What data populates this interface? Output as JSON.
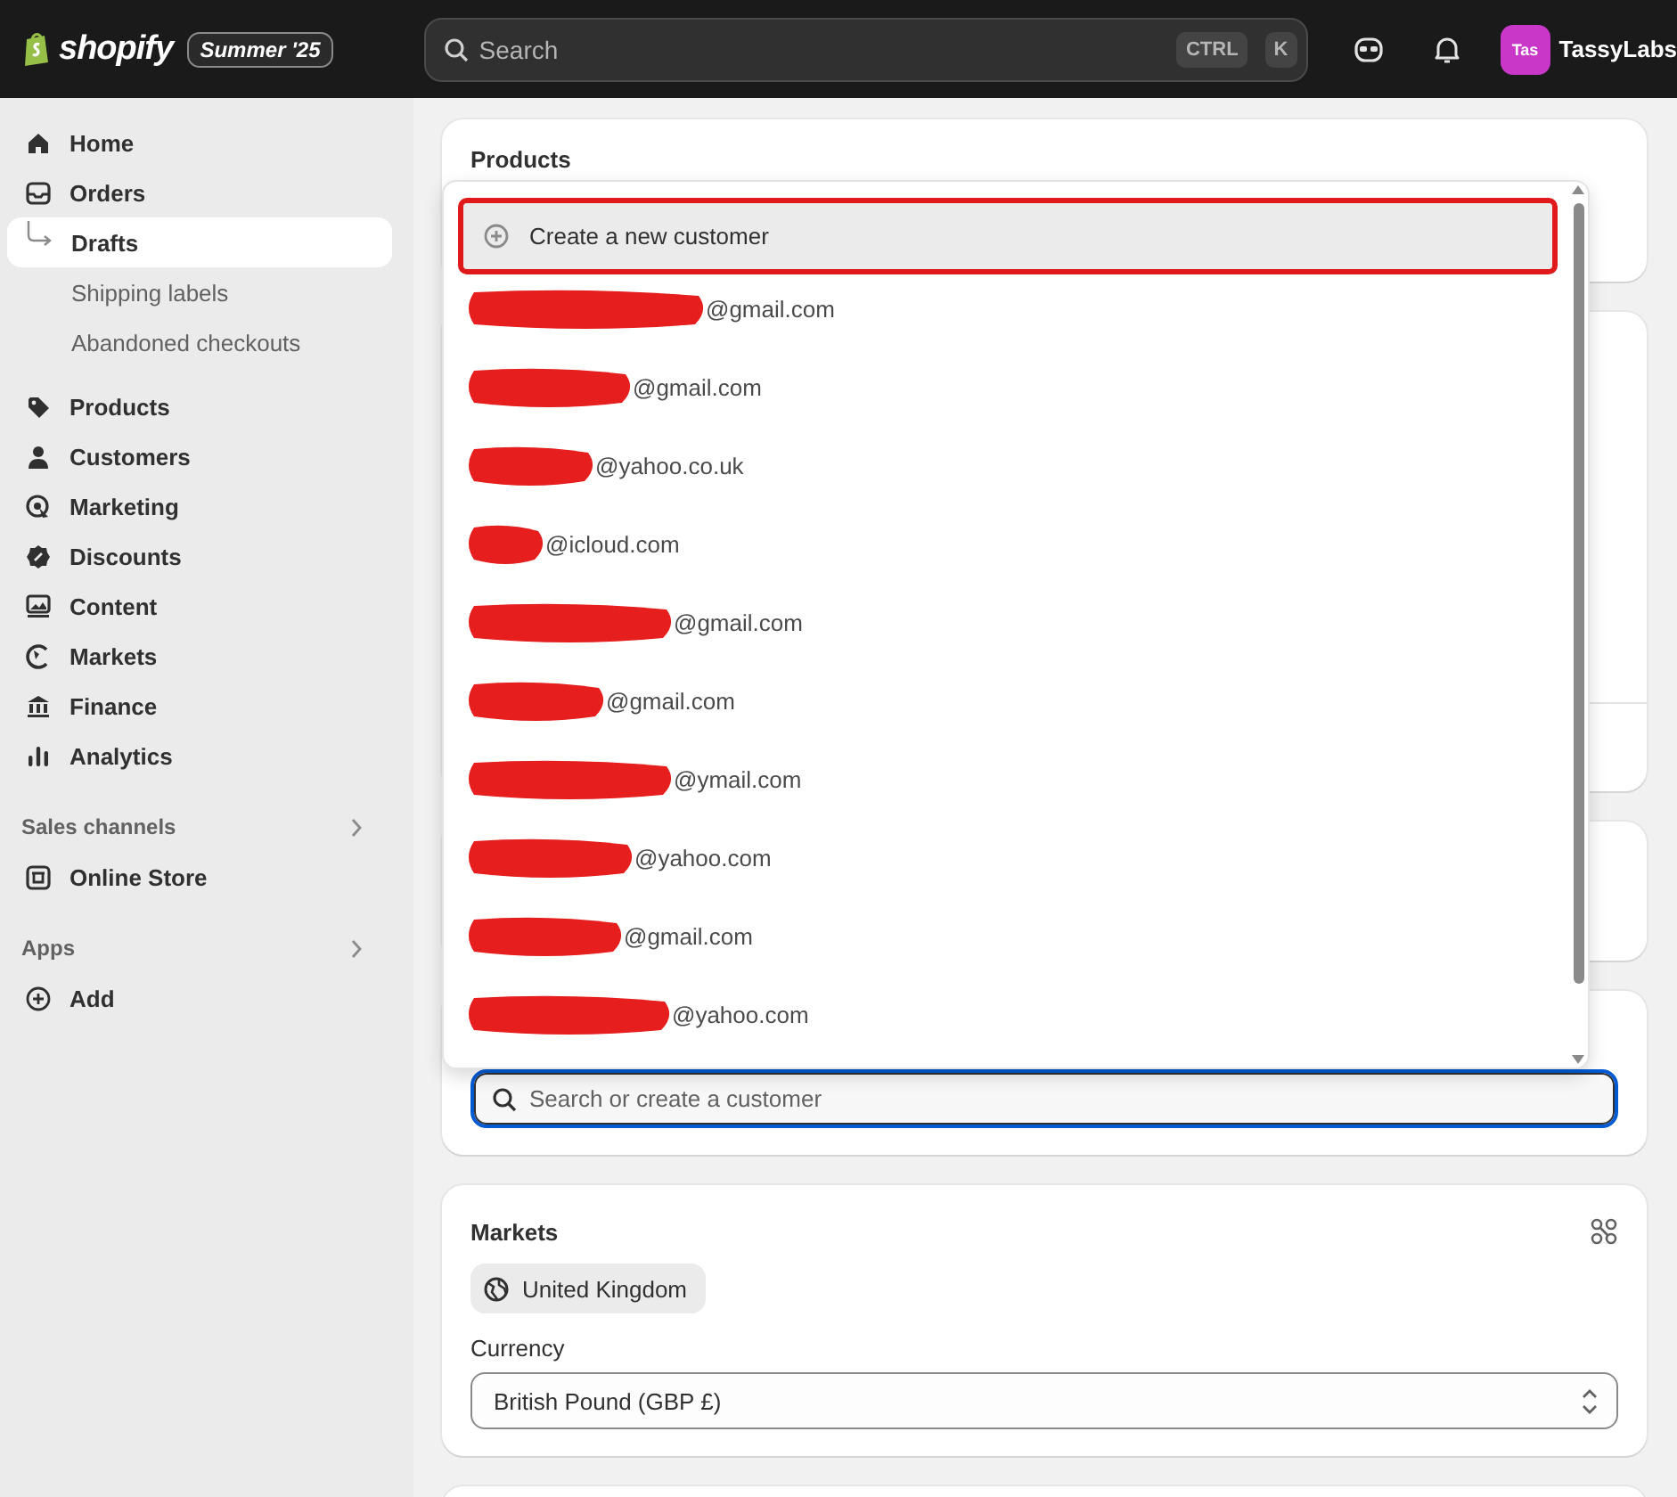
{
  "topbar": {
    "logo_text": "shopify",
    "edition_badge": "Summer '25",
    "search": {
      "placeholder": "Search"
    },
    "shortcut_keys": [
      "CTRL",
      "K"
    ],
    "store_avatar": "Tas",
    "store_name": "TassyLabs"
  },
  "sidebar": {
    "items": [
      {
        "label": "Home",
        "selected": false
      },
      {
        "label": "Orders",
        "selected": false,
        "children": [
          {
            "label": "Drafts",
            "selected": true
          },
          {
            "label": "Shipping labels",
            "selected": false
          },
          {
            "label": "Abandoned checkouts",
            "selected": false
          }
        ]
      },
      {
        "label": "Products",
        "selected": false
      },
      {
        "label": "Customers",
        "selected": false
      },
      {
        "label": "Marketing",
        "selected": false
      },
      {
        "label": "Discounts",
        "selected": false
      },
      {
        "label": "Content",
        "selected": false
      },
      {
        "label": "Markets",
        "selected": false
      },
      {
        "label": "Finance",
        "selected": false
      },
      {
        "label": "Analytics",
        "selected": false
      }
    ],
    "sections": [
      {
        "title": "Sales channels",
        "items": [
          {
            "label": "Online Store",
            "selected": false
          }
        ]
      },
      {
        "title": "Apps",
        "items": [
          {
            "label": "Add",
            "selected": false
          }
        ]
      }
    ]
  },
  "main": {
    "products_card": {
      "title": "Products"
    },
    "customer_card": {
      "search": {
        "placeholder": "Search or create a customer"
      },
      "dropdown": {
        "create_option": {
          "label": "Create a new customer",
          "highlighted": true,
          "annotated": true
        },
        "results": [
          {
            "email": "@gmail.com",
            "redacted": true
          },
          {
            "email": "@gmail.com",
            "redacted": true
          },
          {
            "email": "@yahoo.co.uk",
            "redacted": true
          },
          {
            "email": "@icloud.com",
            "redacted": true
          },
          {
            "email": "@gmail.com",
            "redacted": true
          },
          {
            "email": "@gmail.com",
            "redacted": true
          },
          {
            "email": "@ymail.com",
            "redacted": true
          },
          {
            "email": "@yahoo.com",
            "redacted": true
          },
          {
            "email": "@gmail.com",
            "redacted": true
          },
          {
            "email": "@yahoo.com",
            "redacted": true
          }
        ]
      }
    },
    "markets_card": {
      "title": "Markets",
      "market_tag": "United Kingdom",
      "currency_label": "Currency",
      "currency_value": "British Pound (GBP £)"
    }
  }
}
